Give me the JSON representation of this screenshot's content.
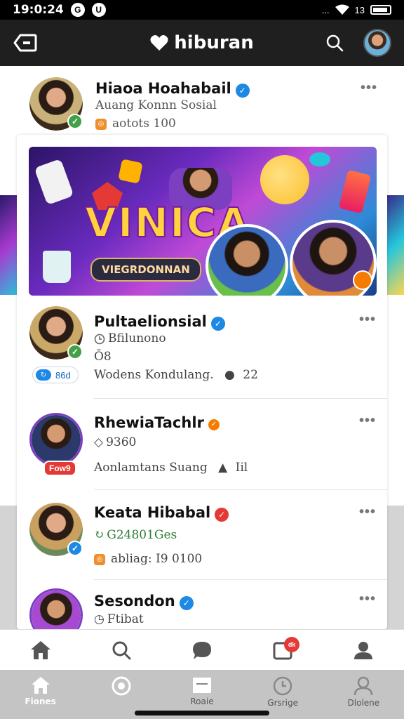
{
  "status_bar": {
    "time": "19:0:24",
    "icon1": "G",
    "icon2": "U",
    "signal_text": "...",
    "signal_value": "13"
  },
  "top_bar": {
    "title": "hiburan",
    "icons": [
      "back-icon",
      "heart-icon",
      "search-icon",
      "avatar"
    ]
  },
  "posts": [
    {
      "name": "Hiaoa Hoahabail",
      "subtitle": "Auang Konnn Sosial",
      "meta": "aotots 100",
      "verified": true
    },
    {
      "name": "Pultaelionsial",
      "line1": "Bfilunono",
      "line2": "Ŏ8",
      "line3": "Wodens Kondulang.",
      "line3_count": "22",
      "stat": "86d",
      "verified": true
    },
    {
      "name": "RhewiaTachlr",
      "badge": "Fow9",
      "line1": "9360",
      "line2": "Aonlamtans Suang",
      "line2_count": "Iil",
      "verified": true
    },
    {
      "name": "Keata Hibabal",
      "line1": "G24801Ges",
      "line2": "abliag: I9 0100",
      "verified": true
    },
    {
      "name": "Sesondon",
      "line1": "Ftibat",
      "verified": true
    }
  ],
  "banner": {
    "title": "VINICA",
    "label": "VIEGRDONNAN"
  },
  "bottom_nav": {
    "notif_badge": "dk"
  },
  "tabs": [
    {
      "label": "Fiones",
      "icon": "home-icon"
    },
    {
      "label": "",
      "icon": "camera-icon"
    },
    {
      "label": "Roaie",
      "icon": "mail-icon"
    },
    {
      "label": "Grsrige",
      "icon": "clock-icon"
    },
    {
      "label": "Dlolene",
      "icon": "user-icon"
    }
  ],
  "colors": {
    "top_bar": "#1f1f1f",
    "verified": "#1e88e5",
    "green": "#43a047",
    "red": "#e53935"
  }
}
